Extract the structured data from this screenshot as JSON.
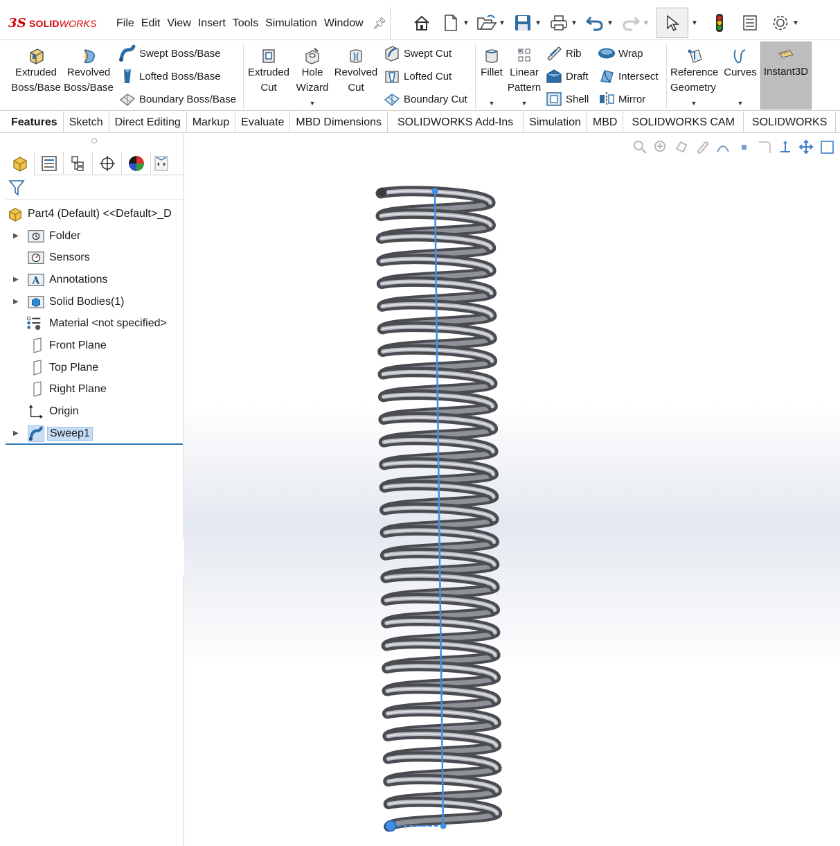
{
  "app": {
    "brand_bold": "SOLID",
    "brand_italic": "WORKS",
    "brand_mark": "3S"
  },
  "menu": [
    "File",
    "Edit",
    "View",
    "Insert",
    "Tools",
    "Simulation",
    "Window"
  ],
  "ribbon": {
    "extruded_boss": [
      "Extruded",
      "Boss/Base"
    ],
    "revolved_boss": [
      "Revolved",
      "Boss/Base"
    ],
    "swept_boss": "Swept Boss/Base",
    "lofted_boss": "Lofted Boss/Base",
    "boundary_boss": "Boundary Boss/Base",
    "extruded_cut": [
      "Extruded",
      "Cut"
    ],
    "hole_wizard": [
      "Hole",
      "Wizard"
    ],
    "revolved_cut": [
      "Revolved",
      "Cut"
    ],
    "swept_cut": "Swept Cut",
    "lofted_cut": "Lofted Cut",
    "boundary_cut": "Boundary Cut",
    "fillet": "Fillet",
    "linear_pattern": [
      "Linear",
      "Pattern"
    ],
    "rib": "Rib",
    "draft": "Draft",
    "shell": "Shell",
    "wrap": "Wrap",
    "intersect": "Intersect",
    "mirror": "Mirror",
    "reference_geometry": [
      "Reference",
      "Geometry"
    ],
    "curves": "Curves",
    "instant3d": "Instant3D"
  },
  "tabs": [
    "Features",
    "Sketch",
    "Direct Editing",
    "Markup",
    "Evaluate",
    "MBD Dimensions",
    "SOLIDWORKS Add-Ins",
    "Simulation",
    "MBD",
    "SOLIDWORKS CAM",
    "SOLIDWORKS"
  ],
  "active_tab": "Features",
  "tree": {
    "root": "Part4 (Default) <<Default>_D",
    "items": [
      {
        "label": "Folder",
        "expandable": true,
        "icon": "folder-icon"
      },
      {
        "label": "Sensors",
        "expandable": false,
        "icon": "sensors-icon"
      },
      {
        "label": "Annotations",
        "expandable": true,
        "icon": "annotations-icon"
      },
      {
        "label": "Solid Bodies(1)",
        "expandable": true,
        "icon": "solid-bodies-icon"
      },
      {
        "label": "Material <not specified>",
        "expandable": false,
        "icon": "material-icon"
      },
      {
        "label": "Front Plane",
        "expandable": false,
        "icon": "plane-icon"
      },
      {
        "label": "Top Plane",
        "expandable": false,
        "icon": "plane-icon"
      },
      {
        "label": "Right Plane",
        "expandable": false,
        "icon": "plane-icon"
      },
      {
        "label": "Origin",
        "expandable": false,
        "icon": "origin-icon"
      },
      {
        "label": "Sweep1",
        "expandable": true,
        "icon": "sweep-icon",
        "selected": true
      }
    ]
  },
  "colors": {
    "selection_blue": "#2e75b6",
    "spring_dark": "#4a4c52",
    "spring_light": "#b8bbc2",
    "axis_blue": "#3d8fe8",
    "brand_red": "#d40000"
  }
}
